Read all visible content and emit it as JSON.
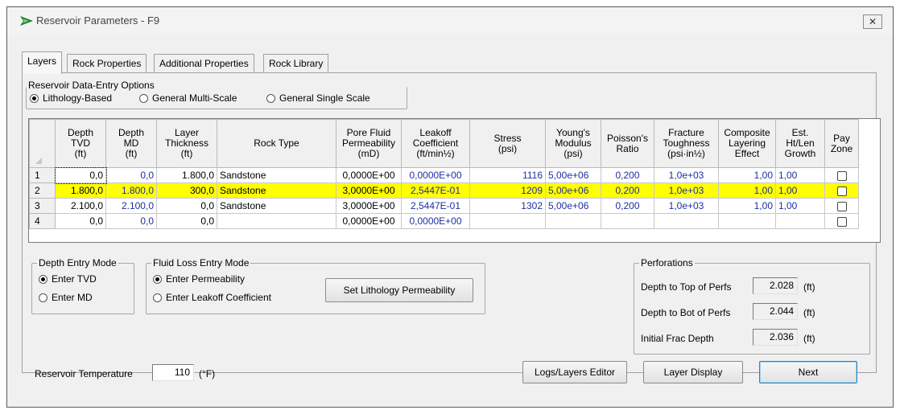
{
  "window": {
    "title": "Reservoir Parameters - F9",
    "close_label": "✕"
  },
  "tabs": [
    {
      "label": "Layers",
      "active": true
    },
    {
      "label": "Rock Properties",
      "active": false
    },
    {
      "label": "Additional Properties",
      "active": false
    },
    {
      "label": "Rock Library",
      "active": false
    }
  ],
  "data_entry_options": {
    "title": "Reservoir Data-Entry Options",
    "options": [
      {
        "label": "Lithology-Based",
        "selected": true
      },
      {
        "label": "General Multi-Scale",
        "selected": false
      },
      {
        "label": "General Single Scale",
        "selected": false
      }
    ]
  },
  "grid": {
    "columns": [
      "",
      "Depth\nTVD\n(ft)",
      "Depth\nMD\n(ft)",
      "Layer\nThickness\n(ft)",
      "Rock Type",
      "Pore Fluid\nPermeability\n(mD)",
      "Leakoff\nCoefficient\n(ft/min½)",
      "Stress\n(psi)",
      "Young's\nModulus\n(psi)",
      "Poisson's\nRatio",
      "Fracture\nToughness\n(psi·in½)",
      "Composite\nLayering\nEffect",
      "Est.\nHt/Len\nGrowth",
      "Pay\nZone"
    ],
    "rows": [
      {
        "num": "1",
        "tvd": "0,0",
        "md": "0,0",
        "thickness": "1.800,0",
        "rock": "Sandstone",
        "perm": "0,0000E+00",
        "leakoff": "0,0000E+00",
        "stress": "1116",
        "youngs": "5,00e+06",
        "poisson": "0,200",
        "toughness": "1,0e+03",
        "composite": "1,00",
        "htlen": "1,00",
        "pay": false,
        "highlight": false
      },
      {
        "num": "2",
        "tvd": "1.800,0",
        "md": "1.800,0",
        "thickness": "300,0",
        "rock": "Sandstone",
        "perm": "3,0000E+00",
        "leakoff": "2,5447E-01",
        "stress": "1209",
        "youngs": "5,00e+06",
        "poisson": "0,200",
        "toughness": "1,0e+03",
        "composite": "1,00",
        "htlen": "1,00",
        "pay": false,
        "highlight": true
      },
      {
        "num": "3",
        "tvd": "2.100,0",
        "md": "2.100,0",
        "thickness": "0,0",
        "rock": "Sandstone",
        "perm": "3,0000E+00",
        "leakoff": "2,5447E-01",
        "stress": "1302",
        "youngs": "5,00e+06",
        "poisson": "0,200",
        "toughness": "1,0e+03",
        "composite": "1,00",
        "htlen": "1,00",
        "pay": false,
        "highlight": false
      },
      {
        "num": "4",
        "tvd": "0,0",
        "md": "0,0",
        "thickness": "0,0",
        "rock": "",
        "perm": "0,0000E+00",
        "leakoff": "0,0000E+00",
        "stress": "",
        "youngs": "",
        "poisson": "",
        "toughness": "",
        "composite": "",
        "htlen": "",
        "pay": false,
        "highlight": false
      }
    ]
  },
  "depth_entry_mode": {
    "title": "Depth Entry Mode",
    "options": [
      {
        "label": "Enter TVD",
        "selected": true
      },
      {
        "label": "Enter MD",
        "selected": false
      }
    ]
  },
  "fluid_loss_mode": {
    "title": "Fluid Loss Entry Mode",
    "options": [
      {
        "label": "Enter Permeability",
        "selected": true
      },
      {
        "label": "Enter Leakoff Coefficient",
        "selected": false
      }
    ],
    "set_button": "Set Lithology Permeability"
  },
  "perforations": {
    "title": "Perforations",
    "top_label": "Depth to Top of Perfs",
    "top_value": "2.028",
    "bot_label": "Depth to Bot of Perfs",
    "bot_value": "2.044",
    "frac_label": "Initial Frac Depth",
    "frac_value": "2.036",
    "unit": "(ft)"
  },
  "temperature": {
    "label": "Reservoir Temperature",
    "value": "110",
    "unit": "(°F)"
  },
  "buttons": {
    "logs": "Logs/Layers Editor",
    "layer_display": "Layer Display",
    "next": "Next"
  },
  "colors": {
    "highlight_row": "#ffff00",
    "computed_value_text": "#1f2f9f",
    "app_icon": "#1a7a2a"
  }
}
